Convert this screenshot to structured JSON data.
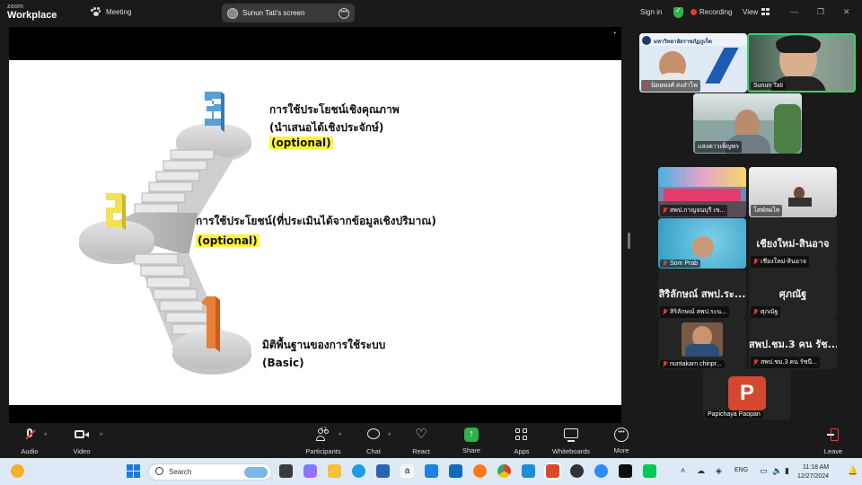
{
  "app": {
    "brand_small": "zoom",
    "brand_large": "Workplace",
    "meeting_label": "Meeting",
    "share_pill": "Sunun Tati's screen",
    "signin": "Sign in",
    "recording": "Recording",
    "view": "View"
  },
  "slide": {
    "step3_line1": "การใช้ประโยชน์เชิงคุณภาพ",
    "step3_line2": "(นำเสนอได้เชิงประจักษ์)",
    "step3_tag": "(optional)",
    "step2_line1": "การใช้ประโยชน์(ที่ประเมินได้จากข้อมูลเชิงปริมาณ)",
    "step2_tag": "(optional)",
    "step1_line1": "มิติพื้นฐานของการใช้ระบบ",
    "step1_line2": "(Basic)",
    "step_numbers": [
      "1",
      "2",
      "3"
    ]
  },
  "gallery": {
    "t1_name": "นิตยพงศ์ สงอำไพ",
    "t1_org": "มหาวิทยาลัยราชภัฏภูเก็ต",
    "t2_name": "Sunun Tati",
    "t3_name": "แสงดาวเพ็ญพร",
    "t4_name": "สพป.กาญจนบุรี เข...",
    "t5_name": "โสฬสผไท",
    "t6_name": "Som Prab",
    "t7_big": "เชียงใหม่-สินอาจ",
    "t7_name": "เชียงใหม่-สินอาจ",
    "t8_big": "สิริลักษณ์ สพป.ระ...",
    "t8_name": "สิริลักษณ์ สพป.ระน...",
    "t9_big": "ศุภณัฐ",
    "t9_name": "ศุภณัฐ",
    "t10_name": "nuntakarn chinpr...",
    "t11_big": "สพป.ชม.3 คน รัช...",
    "t11_name": "สพป.ชม.3 คน รัชนี...",
    "t12_letter": "P",
    "t12_name": "Papichaya Paopan"
  },
  "toolbar": {
    "audio": "Audio",
    "video": "Video",
    "participants": "Participants",
    "participants_count": "12",
    "chat": "Chat",
    "react": "React",
    "share": "Share",
    "apps": "Apps",
    "whiteboards": "Whiteboards",
    "more": "More",
    "leave": "Leave"
  },
  "taskbar": {
    "search": "Search",
    "lang": "ENG",
    "time": "11:18 AM",
    "date": "12/27/2024"
  },
  "colors": {
    "share_green": "#2eb24a",
    "record_red": "#e53935",
    "highlight_yellow": "#fff33a",
    "active_speaker": "#3ad06a"
  }
}
